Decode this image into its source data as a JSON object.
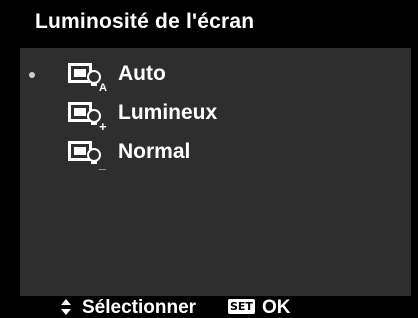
{
  "title": "Luminosité de l'écran",
  "menu": {
    "items": [
      {
        "label": "Auto",
        "icon": "brightness-auto-icon",
        "icon_sub": "A",
        "selected": true
      },
      {
        "label": "Lumineux",
        "icon": "brightness-bright-icon",
        "icon_sub": "+",
        "selected": false
      },
      {
        "label": "Normal",
        "icon": "brightness-normal-icon",
        "icon_sub": "_",
        "selected": false
      }
    ]
  },
  "footer": {
    "nav_icon": "up-down-arrows-icon",
    "select_label": "Sélectionner",
    "set_badge": "SET",
    "ok_label": "OK"
  },
  "colors": {
    "background": "#000000",
    "panel": "#2e2e2e",
    "text": "#ffffff",
    "bullet": "#cfcfcf"
  }
}
